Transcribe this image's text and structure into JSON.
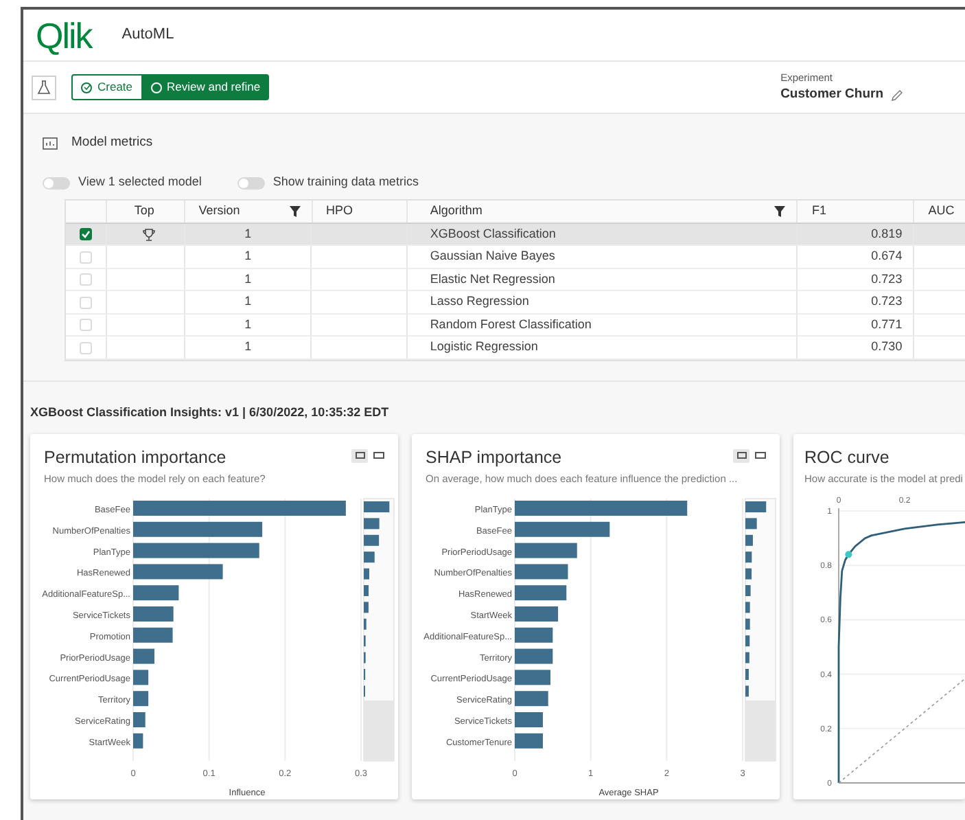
{
  "header": {
    "logo": "Qlik",
    "app_name": "AutoML"
  },
  "steps": [
    {
      "label": "Create",
      "selected": false,
      "done": true
    },
    {
      "label": "Review and refine",
      "selected": true,
      "done": false
    }
  ],
  "experiment": {
    "label": "Experiment",
    "name": "Customer Churn"
  },
  "section_title": "Model metrics",
  "toggles": [
    {
      "label": "View 1 selected model",
      "on": false
    },
    {
      "label": "Show training data metrics",
      "on": false
    }
  ],
  "table": {
    "columns": [
      {
        "label": "Top",
        "filter": false
      },
      {
        "label": "Version",
        "filter": true
      },
      {
        "label": "HPO",
        "filter": false
      },
      {
        "label": "Algorithm",
        "filter": true
      },
      {
        "label": "F1",
        "filter": false
      },
      {
        "label": "AUC",
        "filter": false
      }
    ],
    "rows": [
      {
        "checked": true,
        "selected": true,
        "top": true,
        "version": "1",
        "algorithm": "XGBoost Classification",
        "f1": "0.819"
      },
      {
        "checked": false,
        "selected": false,
        "top": false,
        "version": "1",
        "algorithm": "Gaussian Naive Bayes",
        "f1": "0.674"
      },
      {
        "checked": false,
        "selected": false,
        "top": false,
        "version": "1",
        "algorithm": "Elastic Net Regression",
        "f1": "0.723"
      },
      {
        "checked": false,
        "selected": false,
        "top": false,
        "version": "1",
        "algorithm": "Lasso Regression",
        "f1": "0.723"
      },
      {
        "checked": false,
        "selected": false,
        "top": false,
        "version": "1",
        "algorithm": "Random Forest Classification",
        "f1": "0.771"
      },
      {
        "checked": false,
        "selected": false,
        "top": false,
        "version": "1",
        "algorithm": "Logistic Regression",
        "f1": "0.730"
      }
    ]
  },
  "insights_title": "XGBoost Classification Insights: v1 | 6/30/2022, 10:35:32 EDT",
  "cards": [
    {
      "title": "Permutation importance",
      "subtitle": "How much does the model rely on each feature?",
      "chart_data": {
        "type": "bar",
        "orientation": "horizontal",
        "xlabel": "Influence",
        "categories": [
          "BaseFee",
          "NumberOfPenalties",
          "PlanType",
          "HasRenewed",
          "AdditionalFeatureSp...",
          "ServiceTickets",
          "Promotion",
          "PriorPeriodUsage",
          "CurrentPeriodUsage",
          "Territory",
          "ServiceRating",
          "StartWeek"
        ],
        "grid": true,
        "series": [
          {
            "color": "#3f6f8c",
            "values": [
              0.28,
              0.17,
              0.166,
              0.118,
              0.06,
              0.053,
              0.052,
              0.028,
              0.02,
              0.02,
              0.016,
              0.013
            ]
          }
        ],
        "xlim": [
          0,
          0.3
        ],
        "xticks": [
          {
            "value": 0,
            "label": "0"
          },
          {
            "value": 0.1,
            "label": "0.1"
          },
          {
            "value": 0.2,
            "label": "0.2"
          },
          {
            "value": 0.3,
            "label": "0.3"
          }
        ]
      }
    },
    {
      "title": "SHAP importance",
      "subtitle": "On average, how much does each feature influence the prediction ...",
      "chart_data": {
        "type": "bar",
        "orientation": "horizontal",
        "xlabel": "Average SHAP",
        "categories": [
          "PlanType",
          "BaseFee",
          "PriorPeriodUsage",
          "NumberOfPenalties",
          "HasRenewed",
          "StartWeek",
          "AdditionalFeatureSp...",
          "Territory",
          "CurrentPeriodUsage",
          "ServiceRating",
          "ServiceTickets",
          "CustomerTenure"
        ],
        "grid": true,
        "series": [
          {
            "color": "#3f6f8c",
            "values": [
              2.27,
              1.25,
              0.82,
              0.7,
              0.68,
              0.57,
              0.5,
              0.5,
              0.47,
              0.44,
              0.37,
              0.37
            ]
          }
        ],
        "xlim": [
          0,
          3
        ],
        "xticks": [
          {
            "value": 0,
            "label": "0"
          },
          {
            "value": 1,
            "label": "1"
          },
          {
            "value": 2,
            "label": "2"
          },
          {
            "value": 3,
            "label": "3"
          }
        ]
      }
    },
    {
      "title": "ROC curve",
      "subtitle": "How accurate is the model at predi",
      "chart_data": {
        "type": "line",
        "x": [
          0,
          0,
          0.005,
          0.01,
          0.02,
          0.03,
          0.05,
          0.08,
          0.1,
          0.2,
          0.3,
          0.4
        ],
        "grid": true,
        "series": [
          {
            "color": "#2f5f78",
            "line_style": "solid",
            "values": [
              0,
              0.5,
              0.68,
              0.78,
              0.82,
              0.84,
              0.87,
              0.9,
              0.91,
              0.935,
              0.95,
              0.96
            ]
          },
          {
            "color": "#999999",
            "line_style": "dashed",
            "values": [
              0,
              0,
              0.005,
              0.01,
              0.02,
              0.03,
              0.05,
              0.08,
              0.1,
              0.2,
              0.3,
              0.4
            ]
          }
        ],
        "xlim": [
          0,
          0.4
        ],
        "ylim": [
          0,
          1
        ],
        "xticks": [
          {
            "value": 0,
            "label": "0"
          },
          {
            "value": 0.2,
            "label": "0.2"
          }
        ],
        "yticks": [
          {
            "value": 0,
            "label": "0"
          },
          {
            "value": 0.2,
            "label": "0.2"
          },
          {
            "value": 0.4,
            "label": "0.4"
          },
          {
            "value": 0.6,
            "label": "0.6"
          },
          {
            "value": 0.8,
            "label": "0.8"
          },
          {
            "value": 1,
            "label": "1"
          }
        ]
      }
    }
  ]
}
